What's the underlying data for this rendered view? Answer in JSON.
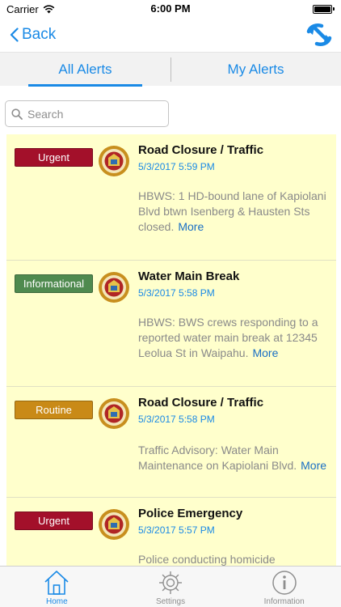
{
  "status_bar": {
    "carrier": "Carrier",
    "time": "6:00 PM"
  },
  "nav": {
    "back_label": "Back",
    "back_icon": "chevron-left-icon",
    "refresh_icon": "sync-arrows-icon"
  },
  "tabs": [
    {
      "label": "All Alerts",
      "selected": true
    },
    {
      "label": "My Alerts",
      "selected": false
    }
  ],
  "search": {
    "placeholder": "Search",
    "value": ""
  },
  "colors": {
    "accent": "#1a8ae6",
    "list_background": "#ffffcc",
    "urgent": "#a3102a",
    "informational": "#4f8a4f",
    "routine": "#c98a17"
  },
  "alerts": [
    {
      "badge": "Urgent",
      "badge_type": "urgent",
      "title": "Road Closure / Traffic",
      "date": "5/3/2017 5:59 PM",
      "body_lines": [
        "HBWS: 1 HD-bound lane of Kapiolani",
        "Blvd btwn Isenberg & Hausten Sts"
      ],
      "body_last": "closed.",
      "more": "More"
    },
    {
      "badge": "Informational",
      "badge_type": "informational",
      "title": "Water Main Break",
      "date": "5/3/2017 5:58 PM",
      "body_lines": [
        "HBWS: BWS crews responding to a",
        "reported water main break at 12345"
      ],
      "body_last": "Leolua St in Waipahu.",
      "more": "More"
    },
    {
      "badge": "Routine",
      "badge_type": "routine",
      "title": "Road Closure / Traffic",
      "date": "5/3/2017 5:58 PM",
      "body_lines": [
        "Traffic Advisory: Water Main"
      ],
      "body_last": "Maintenance on Kapiolani Blvd.",
      "more": "More"
    },
    {
      "badge": "Urgent",
      "badge_type": "urgent",
      "title": "Police Emergency",
      "date": "5/3/2017 5:57 PM",
      "body_lines": [],
      "body_last": "Police conducting homicide",
      "more": ""
    }
  ],
  "tab_bar": [
    {
      "label": "Home",
      "icon": "home-icon",
      "selected": true
    },
    {
      "label": "Settings",
      "icon": "gear-icon",
      "selected": false
    },
    {
      "label": "Information",
      "icon": "info-icon",
      "selected": false
    }
  ]
}
